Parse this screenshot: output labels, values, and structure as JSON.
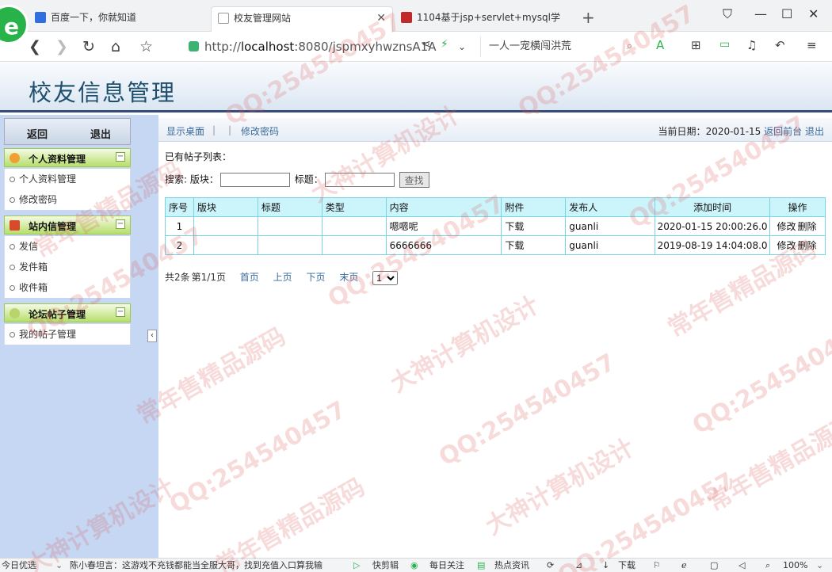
{
  "browser": {
    "tabs": [
      {
        "label": "百度一下，你就知道",
        "icon": "paw-icon",
        "color": "#2f6fe0"
      },
      {
        "label": "校友管理网站",
        "icon": "page-icon",
        "color": "#8a8a8a"
      },
      {
        "label": "1104基于jsp+servlet+mysql学",
        "icon": "site-icon",
        "color": "#c0282a"
      }
    ],
    "url_prefix": "http://",
    "url_host": "localhost",
    "url_rest": ":8080/jspmxyhwznsA1A",
    "search_text": "一人一宠横闯洪荒",
    "logo_letter": "e"
  },
  "header": {
    "title": "校友信息管理"
  },
  "sidebar": {
    "top_buttons": {
      "back": "返回",
      "logout": "退出"
    },
    "groups": [
      {
        "title": "个人资料管理",
        "icon": "gear-icon",
        "color": "#f0a030",
        "items": [
          "个人资料管理",
          "修改密码"
        ]
      },
      {
        "title": "站内信管理",
        "icon": "mail-icon",
        "color": "#d94a2a",
        "items": [
          "发信",
          "发件箱",
          "收件箱"
        ]
      },
      {
        "title": "论坛帖子管理",
        "icon": "forum-icon",
        "color": "#b9d46a",
        "items": [
          "我的帖子管理"
        ]
      }
    ],
    "collapse_glyph": "‹",
    "group_toggle": "−"
  },
  "toolbar": {
    "show_desktop": "显示桌面",
    "change_password": "修改密码",
    "date_label": "当前日期：",
    "date_value": "2020-01-15",
    "back_front": "返回前台",
    "exit": "退出"
  },
  "main": {
    "list_title": "已有帖子列表：",
    "search": {
      "label": "搜索: 版块：",
      "title_label": "标题：",
      "button": "查找",
      "board_value": "",
      "title_value": ""
    },
    "table": {
      "headers": [
        "序号",
        "版块",
        "标题",
        "类型",
        "内容",
        "附件",
        "发布人",
        "添加时间",
        "操作"
      ],
      "rows": [
        {
          "no": "1",
          "board": "",
          "title": "",
          "type": "",
          "content": "嗯嗯呢",
          "attachment": "下载",
          "author": "guanli",
          "time": "2020-01-15 20:00:26.0",
          "edit": "修改",
          "delete": "删除"
        },
        {
          "no": "2",
          "board": "",
          "title": "",
          "type": "",
          "content": "6666666",
          "attachment": "下载",
          "author": "guanli",
          "time": "2019-08-19 14:04:08.0",
          "edit": "修改",
          "delete": "删除"
        }
      ]
    },
    "pager": {
      "total": "共2条",
      "page_info": "第1/1页",
      "first": "首页",
      "prev": "上页",
      "next": "下页",
      "last": "末页",
      "selected_page": "1"
    }
  },
  "statusbar": {
    "items": [
      "今日优选",
      "陈小春坦言：这游戏不充钱都能当全服大哥，找到充值入口算我输",
      "快剪辑",
      "每日关注",
      "热点资讯",
      "下载",
      "100%"
    ]
  },
  "watermarks": [
    "QQ:254540457",
    "常年售精品源码",
    "大神计算机设计"
  ]
}
